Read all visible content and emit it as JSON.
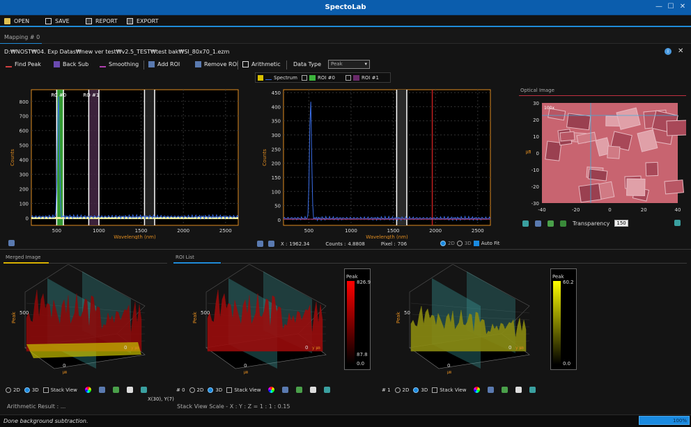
{
  "app": {
    "title": "SpectoLab"
  },
  "menu": [
    "OPEN",
    "SAVE",
    "REPORT",
    "EXPORT"
  ],
  "tab": "Mapping # 0",
  "filepath": "D:₩NOST₩04. Exp Datas₩new ver test₩v2.5_TEST₩test bak₩SI_80x70_1.ezm",
  "toolbar": {
    "find_peak": "Find Peak",
    "back_sub": "Back Sub",
    "smoothing": "Smoothing",
    "add_roi": "Add ROI",
    "remove_roi": "Remove ROI",
    "arithmetic": "Arithmetic",
    "data_type_label": "Data Type",
    "data_type_value": "Peak"
  },
  "legend": {
    "spectrum": "Spectrum",
    "roi0": "ROI #0",
    "roi1": "ROI #1"
  },
  "colors": {
    "accent": "#1f8bd8",
    "axis": "#e08c20",
    "spectrum": "#3a6ee8",
    "roi0": "#3cb43c",
    "roi1": "#6a2a6a",
    "cursor": "#c02020"
  },
  "chart_data": [
    {
      "type": "line",
      "name": "roi-spectrum",
      "xlabel": "Wavelength (nm)",
      "ylabel": "Counts",
      "xlim": [
        200,
        2650
      ],
      "ylim": [
        -50,
        880
      ],
      "xticks": [
        500,
        1000,
        1500,
        2000,
        2500
      ],
      "yticks": [
        0,
        100,
        200,
        300,
        400,
        500,
        600,
        700,
        800
      ],
      "rois": [
        {
          "label": "RC #0",
          "range": [
            500,
            580
          ]
        },
        {
          "label": "RO #1",
          "range": [
            880,
            1000
          ]
        },
        {
          "label": "",
          "range": [
            1540,
            1660
          ]
        }
      ],
      "peak": {
        "x": 520,
        "y": 850
      }
    },
    {
      "type": "line",
      "name": "main-spectrum",
      "xlabel": "Wavelength (nm)",
      "ylabel": "Counts",
      "xlim": [
        200,
        2650
      ],
      "ylim": [
        -20,
        460
      ],
      "xticks": [
        500,
        1000,
        1500,
        2000,
        2500
      ],
      "yticks": [
        0,
        50,
        100,
        150,
        200,
        250,
        300,
        350,
        400,
        450
      ],
      "peak": {
        "x": 520,
        "y": 425
      },
      "cursor_x": 1962
    }
  ],
  "optical": {
    "title": "Optical Image",
    "xticks": [
      "-40",
      "-20",
      "0",
      "20",
      "40"
    ],
    "yticks": [
      "30",
      "20",
      "10",
      "0",
      "-10",
      "-20",
      "-30"
    ],
    "unit": "㎛",
    "zoom": "100x",
    "transparency_label": "Transparency",
    "transparency_value": "150"
  },
  "status_row": {
    "x_label": "X :",
    "x_value": "1962.34",
    "counts_label": "Counts :",
    "counts_value": "4.8808",
    "pixel_label": "Pixel :",
    "pixel_value": "706",
    "opt2d": "2D",
    "opt3d": "3D",
    "autofit": "Auto Fit"
  },
  "panels": {
    "merged": "Merged Image",
    "roi_list": "ROI List"
  },
  "cb0": {
    "label": "Peak",
    "max": "826.9",
    "min": "87.8",
    "zero": "0.0"
  },
  "cb1": {
    "label": "Peak",
    "max": "60.2",
    "zero": "0.0"
  },
  "bottom": {
    "d2": "2D",
    "d3": "3D",
    "stack": "Stack View",
    "roi0": "# 0",
    "roi1": "# 1",
    "coords": "X(30), Y(7)",
    "arith": "Arithmetic Result :",
    "arith_value": "...",
    "scale": "Stack View Scale - X : Y : Z = 1 : 1 : 0.15"
  },
  "plot3d": {
    "ylabel": "Peak",
    "z500": "500",
    "z50": "50",
    "zero": "0",
    "axis_y": "y ㎛",
    "axis_x": "㎛"
  },
  "status": {
    "message": "Done background subtraction.",
    "progress": "100%"
  }
}
